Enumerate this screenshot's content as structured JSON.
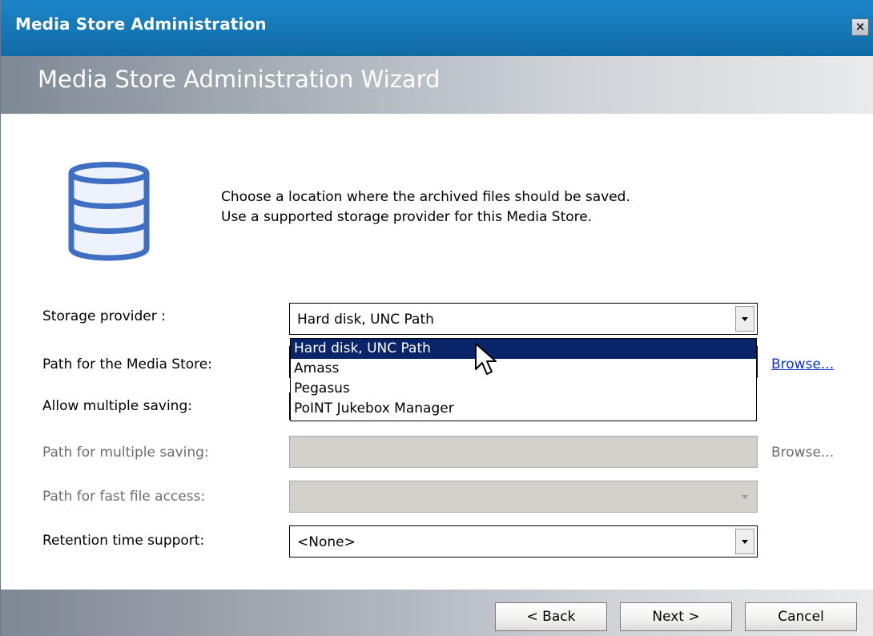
{
  "window": {
    "title": "Media Store Administration",
    "close_label": "×"
  },
  "banner": {
    "title": "Media Store Administration Wizard"
  },
  "instructions": {
    "line1": "Choose a location where the archived files should be saved.",
    "line2": "Use a supported storage provider for this Media Store."
  },
  "form": {
    "storage_provider": {
      "label": "Storage provider :",
      "value": "Hard disk, UNC Path",
      "options": [
        "Hard disk, UNC Path",
        "Amass",
        "Pegasus",
        "PoINT Jukebox Manager"
      ]
    },
    "media_store_path": {
      "label": "Path for the Media Store:",
      "browse_label": "Browse..."
    },
    "allow_multiple": {
      "label": "Allow multiple saving:"
    },
    "multiple_path": {
      "label": "Path for multiple saving:",
      "value": "",
      "browse_label": "Browse..."
    },
    "fast_access": {
      "label": "Path for fast file access:",
      "value": ""
    },
    "retention": {
      "label": "Retention time support:",
      "value": "<None>"
    }
  },
  "footer": {
    "back_label": "< Back",
    "next_label": "Next >",
    "cancel_label": "Cancel"
  },
  "colors": {
    "titlebar": "#1577b6",
    "selection": "#0a246a",
    "link": "#0a35d4",
    "disabled_field": "#d3d1cc",
    "icon_stroke": "#3f6fc2"
  }
}
